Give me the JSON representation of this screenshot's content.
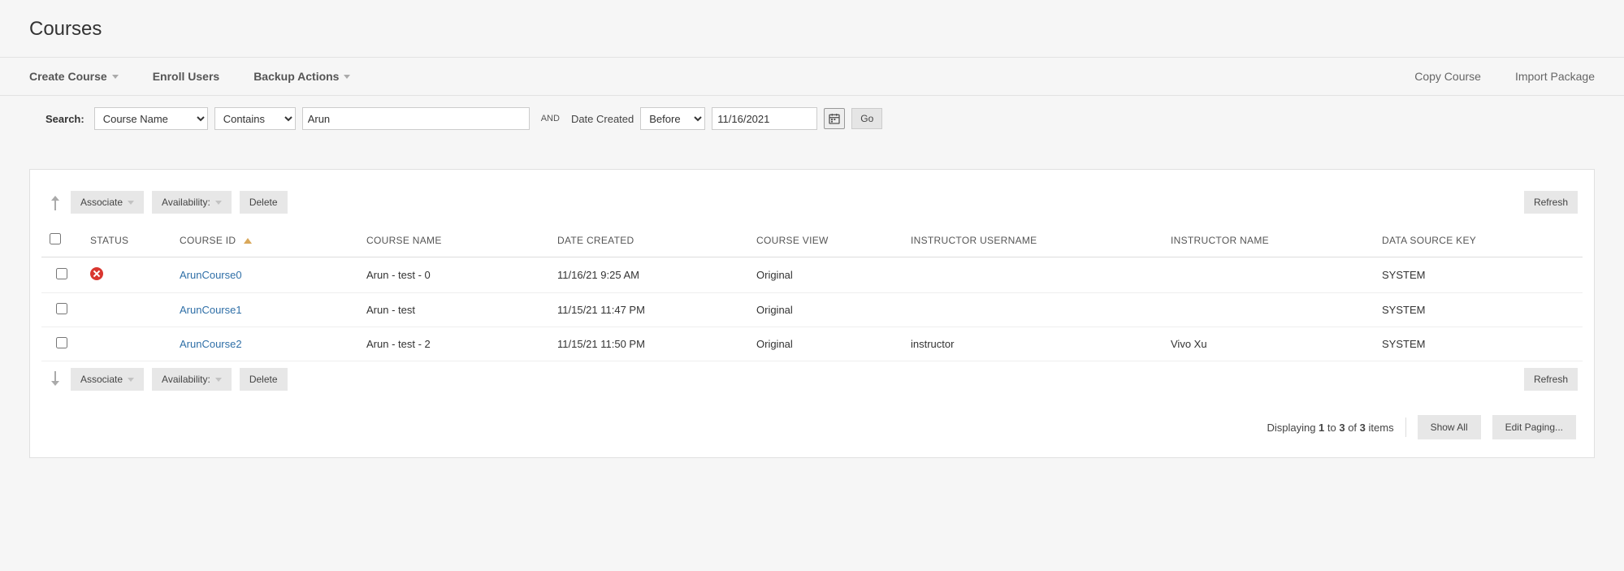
{
  "page_title": "Courses",
  "menu": {
    "create_course": "Create Course",
    "enroll_users": "Enroll Users",
    "backup_actions": "Backup Actions",
    "copy_course": "Copy Course",
    "import_package": "Import Package"
  },
  "search": {
    "label": "Search:",
    "field_selected": "Course Name",
    "operator_selected": "Contains",
    "term_value": "Arun",
    "and_label": "AND",
    "date_label": "Date Created",
    "date_op_selected": "Before",
    "date_value": "11/16/2021",
    "go_label": "Go"
  },
  "actions": {
    "associate": "Associate",
    "availability": "Availability:",
    "delete": "Delete",
    "refresh": "Refresh"
  },
  "columns": {
    "status": "STATUS",
    "course_id": "COURSE ID",
    "course_name": "COURSE NAME",
    "date_created": "DATE CREATED",
    "course_view": "COURSE VIEW",
    "instructor_username": "INSTRUCTOR USERNAME",
    "instructor_name": "INSTRUCTOR NAME",
    "data_source_key": "DATA SOURCE KEY"
  },
  "rows": [
    {
      "status": "unavailable",
      "course_id": "ArunCourse0",
      "course_name": "Arun - test - 0",
      "date_created": "11/16/21 9:25 AM",
      "course_view": "Original",
      "instructor_username": "",
      "instructor_name": "",
      "data_source_key": "SYSTEM"
    },
    {
      "status": "",
      "course_id": "ArunCourse1",
      "course_name": "Arun - test",
      "date_created": "11/15/21 11:47 PM",
      "course_view": "Original",
      "instructor_username": "",
      "instructor_name": "",
      "data_source_key": "SYSTEM"
    },
    {
      "status": "",
      "course_id": "ArunCourse2",
      "course_name": "Arun - test - 2",
      "date_created": "11/15/21 11:50 PM",
      "course_view": "Original",
      "instructor_username": "instructor",
      "instructor_name": "Vivo Xu",
      "data_source_key": "SYSTEM"
    }
  ],
  "paging": {
    "prefix": "Displaying ",
    "from": "1",
    "to_word": " to ",
    "to": "3",
    "of_word": " of ",
    "total": "3",
    "suffix": " items",
    "show_all": "Show All",
    "edit_paging": "Edit Paging..."
  }
}
